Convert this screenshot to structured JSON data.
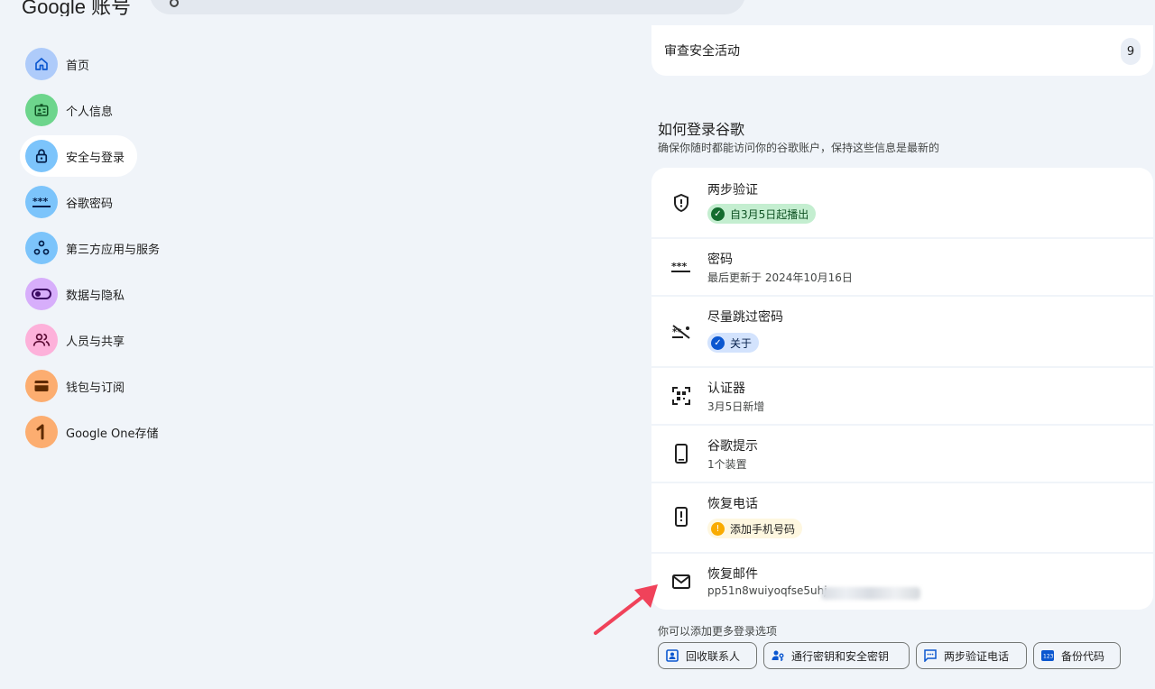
{
  "header": {
    "logo_text": "Google 账号"
  },
  "sidebar": {
    "items": [
      {
        "label": "首页",
        "icon": "home-icon",
        "color": "#aecbfa"
      },
      {
        "label": "个人信息",
        "icon": "id-card-icon",
        "color": "#81c995"
      },
      {
        "label": "安全与登录",
        "icon": "lock-icon",
        "color": "#8ab4f8"
      },
      {
        "label": "谷歌密码",
        "icon": "password-icon",
        "color": "#8ab4f8"
      },
      {
        "label": "第三方应用与服务",
        "icon": "apps-icon",
        "color": "#8ab4f8"
      },
      {
        "label": "数据与隐私",
        "icon": "toggle-icon",
        "color": "#d7aefb"
      },
      {
        "label": "人员与共享",
        "icon": "people-icon",
        "color": "#fdcfe8"
      },
      {
        "label": "钱包与订阅",
        "icon": "wallet-icon",
        "color": "#fcad70"
      },
      {
        "label": "Google One存储",
        "icon": "google-one-icon",
        "color": "#fcad70"
      }
    ]
  },
  "security": {
    "review_label": "审查安全活动",
    "review_count": "9",
    "signin_title": "如何登录谷歌",
    "signin_subtitle": "确保你随时都能访问你的谷歌账户，保持这些信息是最新的",
    "rows": [
      {
        "title": "两步验证",
        "chip": "自3月5日起播出",
        "chip_color": "#c4eed0",
        "chip_dot": "#146c2e"
      },
      {
        "title": "密码",
        "subtitle": "最后更新于 2024年10月16日"
      },
      {
        "title": "尽量跳过密码",
        "chip": "关于",
        "chip_color": "#d3e3fd",
        "chip_dot": "#0b57d0"
      },
      {
        "title": "认证器",
        "subtitle": "3月5日新增"
      },
      {
        "title": "谷歌提示",
        "subtitle": "1个装置"
      },
      {
        "title": "恢复电话",
        "chip": "添加手机号码",
        "chip_color": "#fef7e0",
        "chip_dot": "#f9ab00"
      },
      {
        "title": "恢复邮件",
        "subtitle": "pp51n8wuiyoqfse5uhj"
      }
    ],
    "more_title": "你可以添加更多登录选项",
    "options": [
      "回收联系人",
      "通行密钥和安全密钥",
      "两步验证电话",
      "备份代码"
    ]
  }
}
